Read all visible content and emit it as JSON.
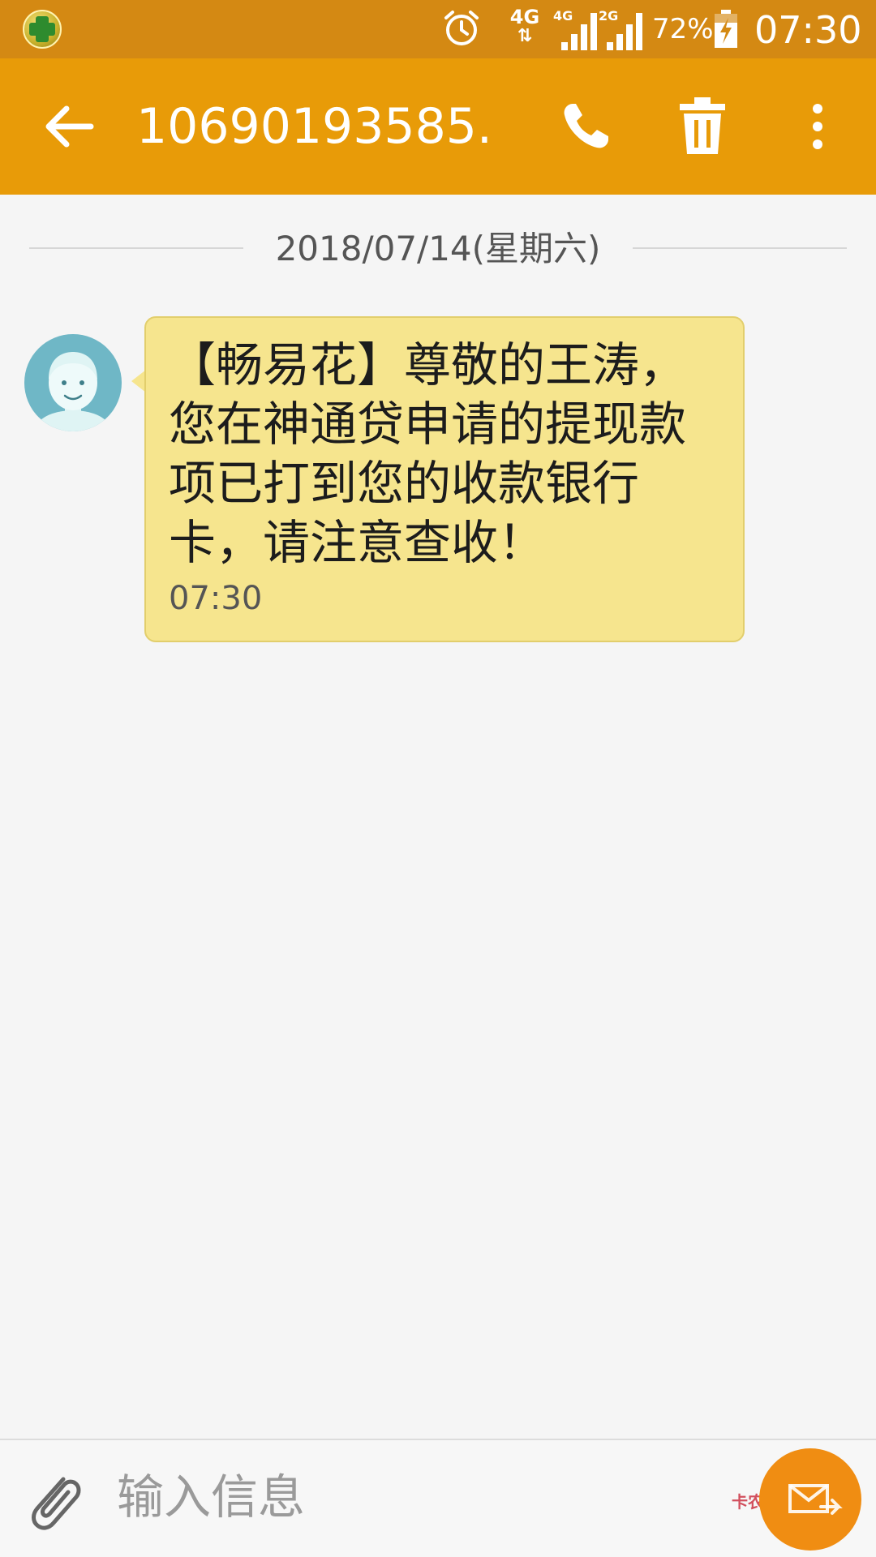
{
  "status_bar": {
    "network": "4G",
    "signal_1_tag": "4G",
    "signal_2_tag": "2G",
    "battery_percent": "72%",
    "time": "07:30"
  },
  "toolbar": {
    "title": "10690193585..."
  },
  "conversation": {
    "date": "2018/07/14(星期六)",
    "messages": [
      {
        "text": "【畅易花】尊敬的王涛，您在神通贷申请的提现款项已打到您的收款银行卡，请注意查收！",
        "time": "07:30"
      }
    ]
  },
  "compose": {
    "placeholder": "输入信息"
  },
  "watermark": "卡农社区",
  "colors": {
    "status_bar": "#d48913",
    "toolbar": "#e89b08",
    "bubble": "#f6e58e",
    "send_button": "#f08d12",
    "avatar": "#6fb7c6"
  }
}
